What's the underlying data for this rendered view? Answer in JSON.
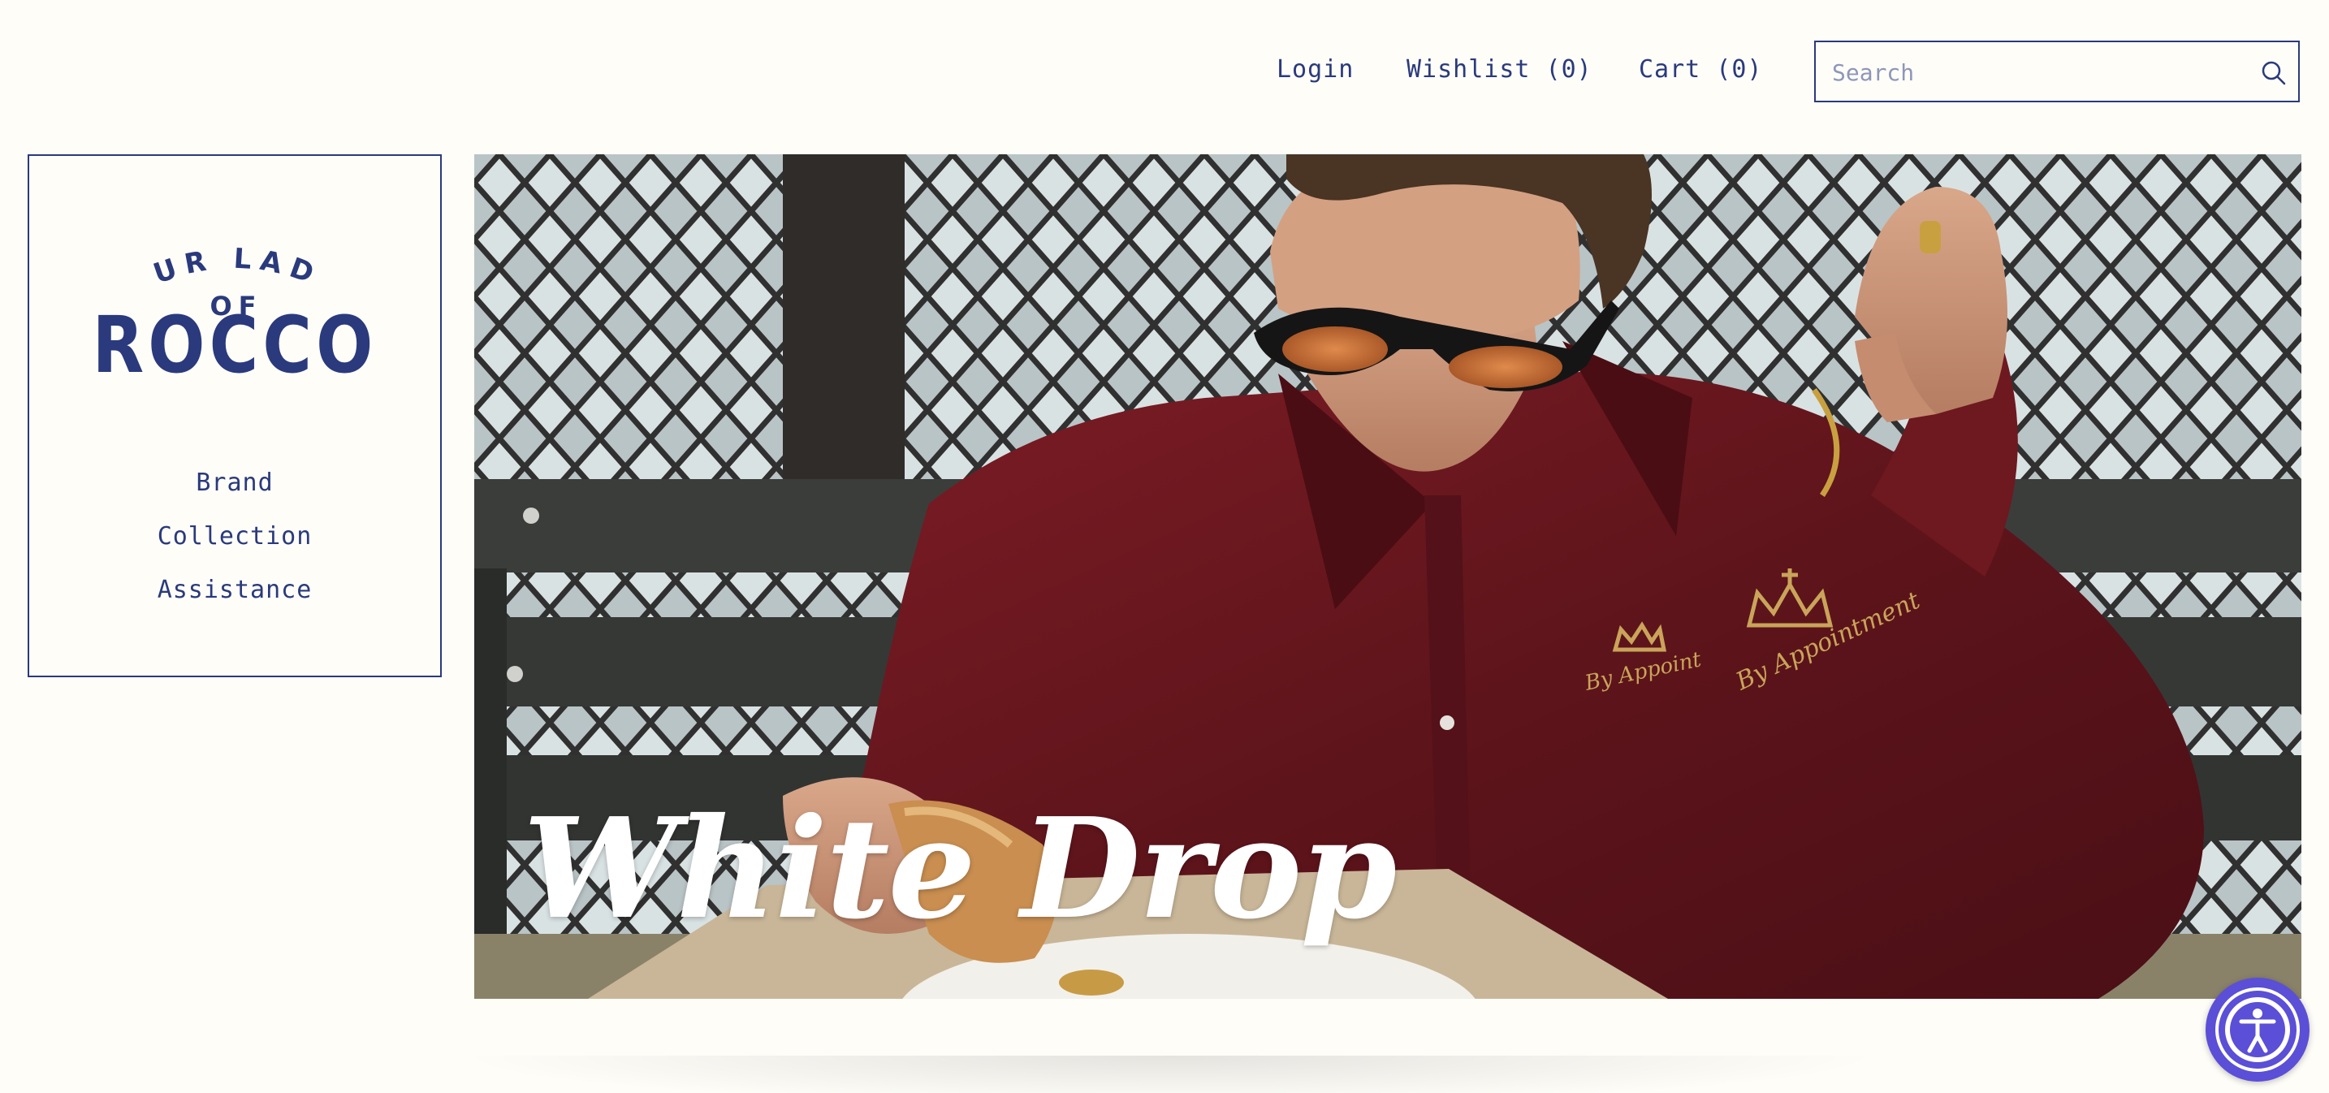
{
  "header": {
    "nav": {
      "login": "Login",
      "wishlist": "Wishlist (0)",
      "cart": "Cart (0)"
    },
    "search": {
      "placeholder": "Search",
      "value": ""
    }
  },
  "sidebar": {
    "logo": {
      "line1": "OUR LADY",
      "line2": "OF",
      "line3": "ROCCO"
    },
    "menu": [
      {
        "label": "Brand"
      },
      {
        "label": "Collection"
      },
      {
        "label": "Assistance"
      }
    ]
  },
  "hero": {
    "title": "White Drop"
  },
  "colors": {
    "brand": "#2a3a7c",
    "background": "#fefdf8",
    "accessibility_button": "#5a4fd6"
  },
  "icons": {
    "search": "search-icon",
    "accessibility": "accessibility-icon"
  }
}
